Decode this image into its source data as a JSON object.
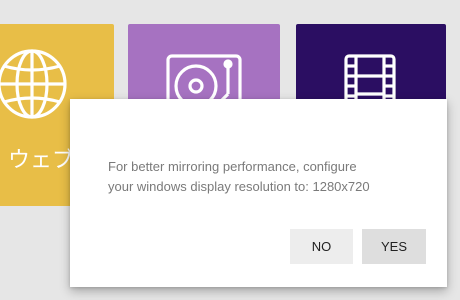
{
  "tiles": [
    {
      "name": "web",
      "label": "ウェブ",
      "icon": "globe-icon",
      "color": "#e8be47"
    },
    {
      "name": "music",
      "label": "",
      "icon": "turntable-icon",
      "color": "#a672c1"
    },
    {
      "name": "video",
      "label": "",
      "icon": "film-icon",
      "color": "#2b0e62"
    }
  ],
  "dialog": {
    "message_line1": "For better mirroring performance, configure",
    "message_line2": "your windows display resolution to: 1280x720",
    "no_label": "NO",
    "yes_label": "YES"
  }
}
